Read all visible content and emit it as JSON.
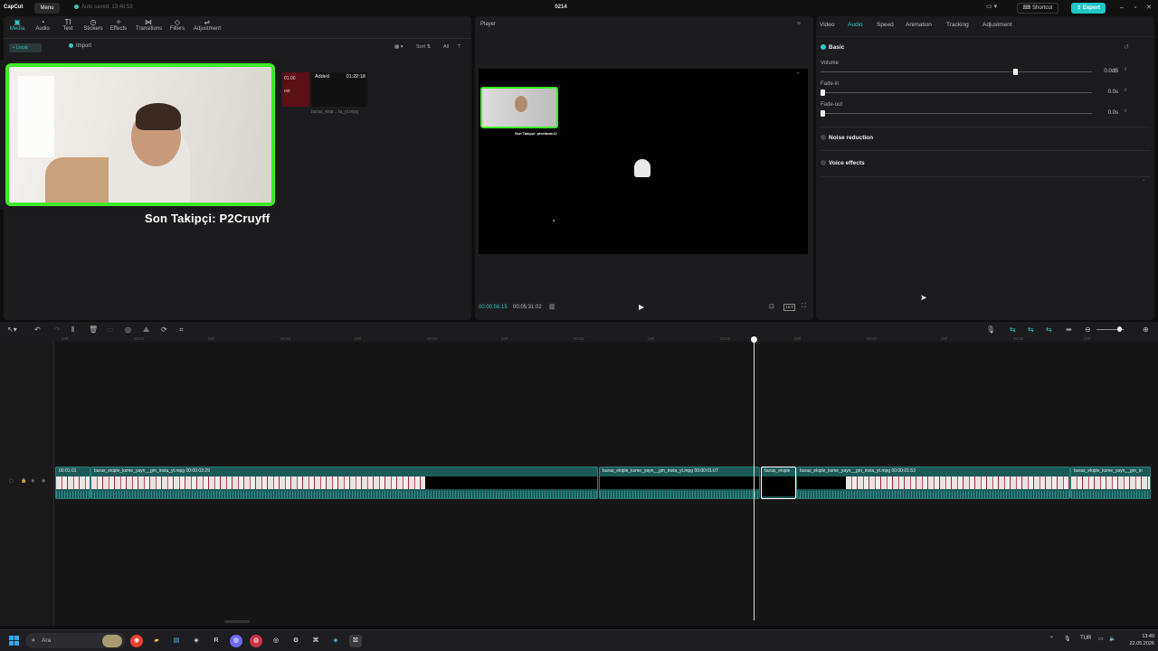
{
  "titlebar": {
    "app": "CapCut",
    "menu_label": "Menu",
    "autosave": "Auto saved: 13:48:53",
    "project_name": "0214",
    "shortcut_label": "Shortcut",
    "export_label": "Export"
  },
  "media_tabs": [
    "Media",
    "Audio",
    "Text",
    "Stickers",
    "Effects",
    "Transitions",
    "Filters",
    "Adjustment"
  ],
  "media_panel": {
    "local_label": "• Local",
    "import_label": "Import",
    "sort_label": "Sort",
    "all_label": "All",
    "thumb1_time": "01:00",
    "thumb1_text": "ost",
    "thumb2_added": "Added",
    "thumb2_duration": "01:22:18",
    "thumb2_name": "buras_ekip... ta_yt.mpg"
  },
  "webcam_caption": "Son Takipçi: P2Cruyff",
  "player": {
    "label": "Player",
    "preview_caption": "Son Takipçi: pixeltude12",
    "current_time": "00:00:56:15",
    "total_time": "00:05:31:02",
    "ratio_label": "16:9"
  },
  "right_tabs": [
    "Video",
    "Audio",
    "Speed",
    "Animation",
    "Tracking",
    "Adjustment"
  ],
  "audio": {
    "basic_label": "Basic",
    "volume_label": "Volume",
    "volume_value": "0.0dB",
    "volume_level": 0.71,
    "fadein_label": "Fade-in",
    "fadein_value": "0.0s",
    "fadeout_label": "Fade-out",
    "fadeout_value": "0.0s",
    "noise_label": "Noise reduction",
    "voice_label": "Voice effects"
  },
  "ruler_ticks": [
    "|30f",
    "00:52",
    "|30f",
    "00:53",
    "|30f",
    "00:54",
    "|30f",
    "00:55",
    "|30f",
    "00:56",
    "|30f",
    "00:57",
    "|30f",
    "00:58",
    "|30f",
    "00:59",
    "|30f"
  ],
  "clips": [
    {
      "label": "00:01:01",
      "dark": false
    },
    {
      "label": "buras_ekiple_ksme_yayn__gm_insta_yt.mpg  00:00:03:29",
      "dark": false
    },
    {
      "label": "buras_ekiple_ksme_yayn__gm_insta_yt.mpg  00:00:01:07",
      "dark": true
    },
    {
      "label": "buras_ekiple",
      "dark": true
    },
    {
      "label": "buras_ekiple_ksme_yayn__gm_insta_yt.mpg  00:00:01:53",
      "dark": false
    },
    {
      "label": "buras_ekiple_ksme_yayn__gm_in",
      "dark": false
    }
  ],
  "taskbar": {
    "search_placeholder": "Ara",
    "lang": "TUR",
    "time": "13:49",
    "date": "22.05.2026"
  },
  "colors": {
    "accent": "#2fc7c7",
    "webcam_border": "#3eea2a",
    "clip_bg": "#1a5a57"
  }
}
